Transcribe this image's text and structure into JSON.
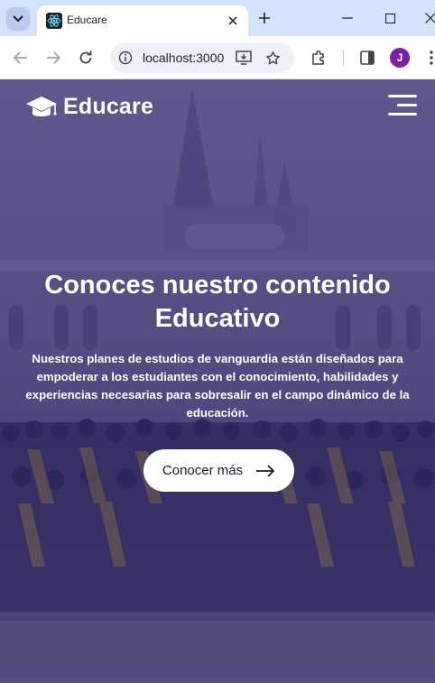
{
  "browser": {
    "tab_title": "Educare",
    "url": "localhost:3000",
    "profile_initial": "J"
  },
  "site": {
    "brand": "Educare",
    "hero_title_line1": "Conoces nuestro contenido",
    "hero_title_line2": "Educativo",
    "hero_text": "Nuestros planes de estudios de vanguardia están diseñados para empoderar a los estudiantes con el conocimiento, habilidades y experiencias necesarias para sobresalir en el campo dinámico de la educación.",
    "cta_label": "Conocer más"
  },
  "colors": {
    "tabstrip": "#d3e3fd",
    "hero_overlay": "#3c3278",
    "cta_bg": "#ffffff",
    "profile": "#7b1fa2"
  },
  "icons": [
    "tab-search-icon",
    "react-favicon-icon",
    "close-icon",
    "plus-icon",
    "minimize-icon",
    "maximize-icon",
    "window-close-icon",
    "back-icon",
    "forward-icon",
    "reload-icon",
    "site-info-icon",
    "install-app-icon",
    "bookmark-star-icon",
    "extensions-icon",
    "side-panel-icon",
    "more-menu-icon",
    "graduation-cap-icon",
    "hamburger-menu-icon",
    "arrow-right-icon"
  ]
}
